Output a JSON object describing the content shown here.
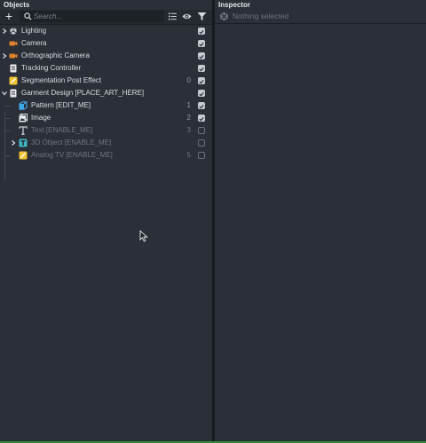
{
  "objects_panel": {
    "title": "Objects",
    "add_label": "+",
    "search_placeholder": "Search...",
    "toolbar_icons": [
      "sort-list-icon",
      "eye-icon",
      "filter-icon"
    ],
    "items": [
      {
        "label": "Lighting",
        "icon": "lighting-icon",
        "icon_color": "#c9ccd3",
        "expandable": true,
        "expanded": false,
        "depth": 0,
        "count": "",
        "checked": true,
        "disabled": false
      },
      {
        "label": "Camera",
        "icon": "camera-icon",
        "icon_color": "#e0822b",
        "expandable": false,
        "depth": 0,
        "count": "",
        "checked": true,
        "disabled": false
      },
      {
        "label": "Orthographic Camera",
        "icon": "camera-icon",
        "icon_color": "#e0822b",
        "expandable": true,
        "expanded": false,
        "depth": 0,
        "count": "",
        "checked": true,
        "disabled": false
      },
      {
        "label": "Tracking Controller",
        "icon": "tracking-controller-icon",
        "icon_color": "#e6e7ea",
        "expandable": false,
        "depth": 0,
        "count": "",
        "checked": true,
        "disabled": false
      },
      {
        "label": "Segmentation Post Effect",
        "icon": "post-effect-icon",
        "icon_color": "#f1c232",
        "expandable": false,
        "depth": 0,
        "count": "0",
        "checked": true,
        "disabled": false
      },
      {
        "label": "Garment Design [PLACE_ART_HERE]",
        "icon": "garment-icon",
        "icon_color": "#e6e7ea",
        "expandable": true,
        "expanded": true,
        "depth": 0,
        "count": "",
        "checked": true,
        "disabled": false
      },
      {
        "label": "Pattern [EDIT_ME]",
        "icon": "pattern-cube-icon",
        "icon_color": "#3fa7e6",
        "expandable": false,
        "depth": 1,
        "count": "1",
        "checked": true,
        "disabled": false
      },
      {
        "label": "Image",
        "icon": "image-icon",
        "icon_color": "#e6e7ea",
        "expandable": false,
        "depth": 1,
        "count": "2",
        "checked": true,
        "disabled": false
      },
      {
        "label": "Text [ENABLE_ME]",
        "icon": "text-icon",
        "icon_color": "#c9ccd3",
        "expandable": false,
        "depth": 1,
        "count": "3",
        "checked": false,
        "disabled": true
      },
      {
        "label": "3D Object [ENABLE_ME]",
        "icon": "3d-object-icon",
        "icon_color": "#3fb6c0",
        "expandable": true,
        "expanded": false,
        "depth": 1,
        "count": "",
        "checked": false,
        "disabled": true
      },
      {
        "label": "Analog TV [ENABLE_ME]",
        "icon": "post-effect-icon",
        "icon_color": "#f1c232",
        "expandable": false,
        "depth": 1,
        "count": "5",
        "checked": false,
        "disabled": true
      }
    ]
  },
  "inspector_panel": {
    "title": "Inspector",
    "empty_text": "Nothing selected",
    "empty_icon": "no-selection-icon"
  },
  "colors": {
    "panel_bg": "#2b2f38",
    "divider": "#16191d",
    "checkbox_on": "#c7cad0",
    "status_strip": "#2e8b35"
  }
}
